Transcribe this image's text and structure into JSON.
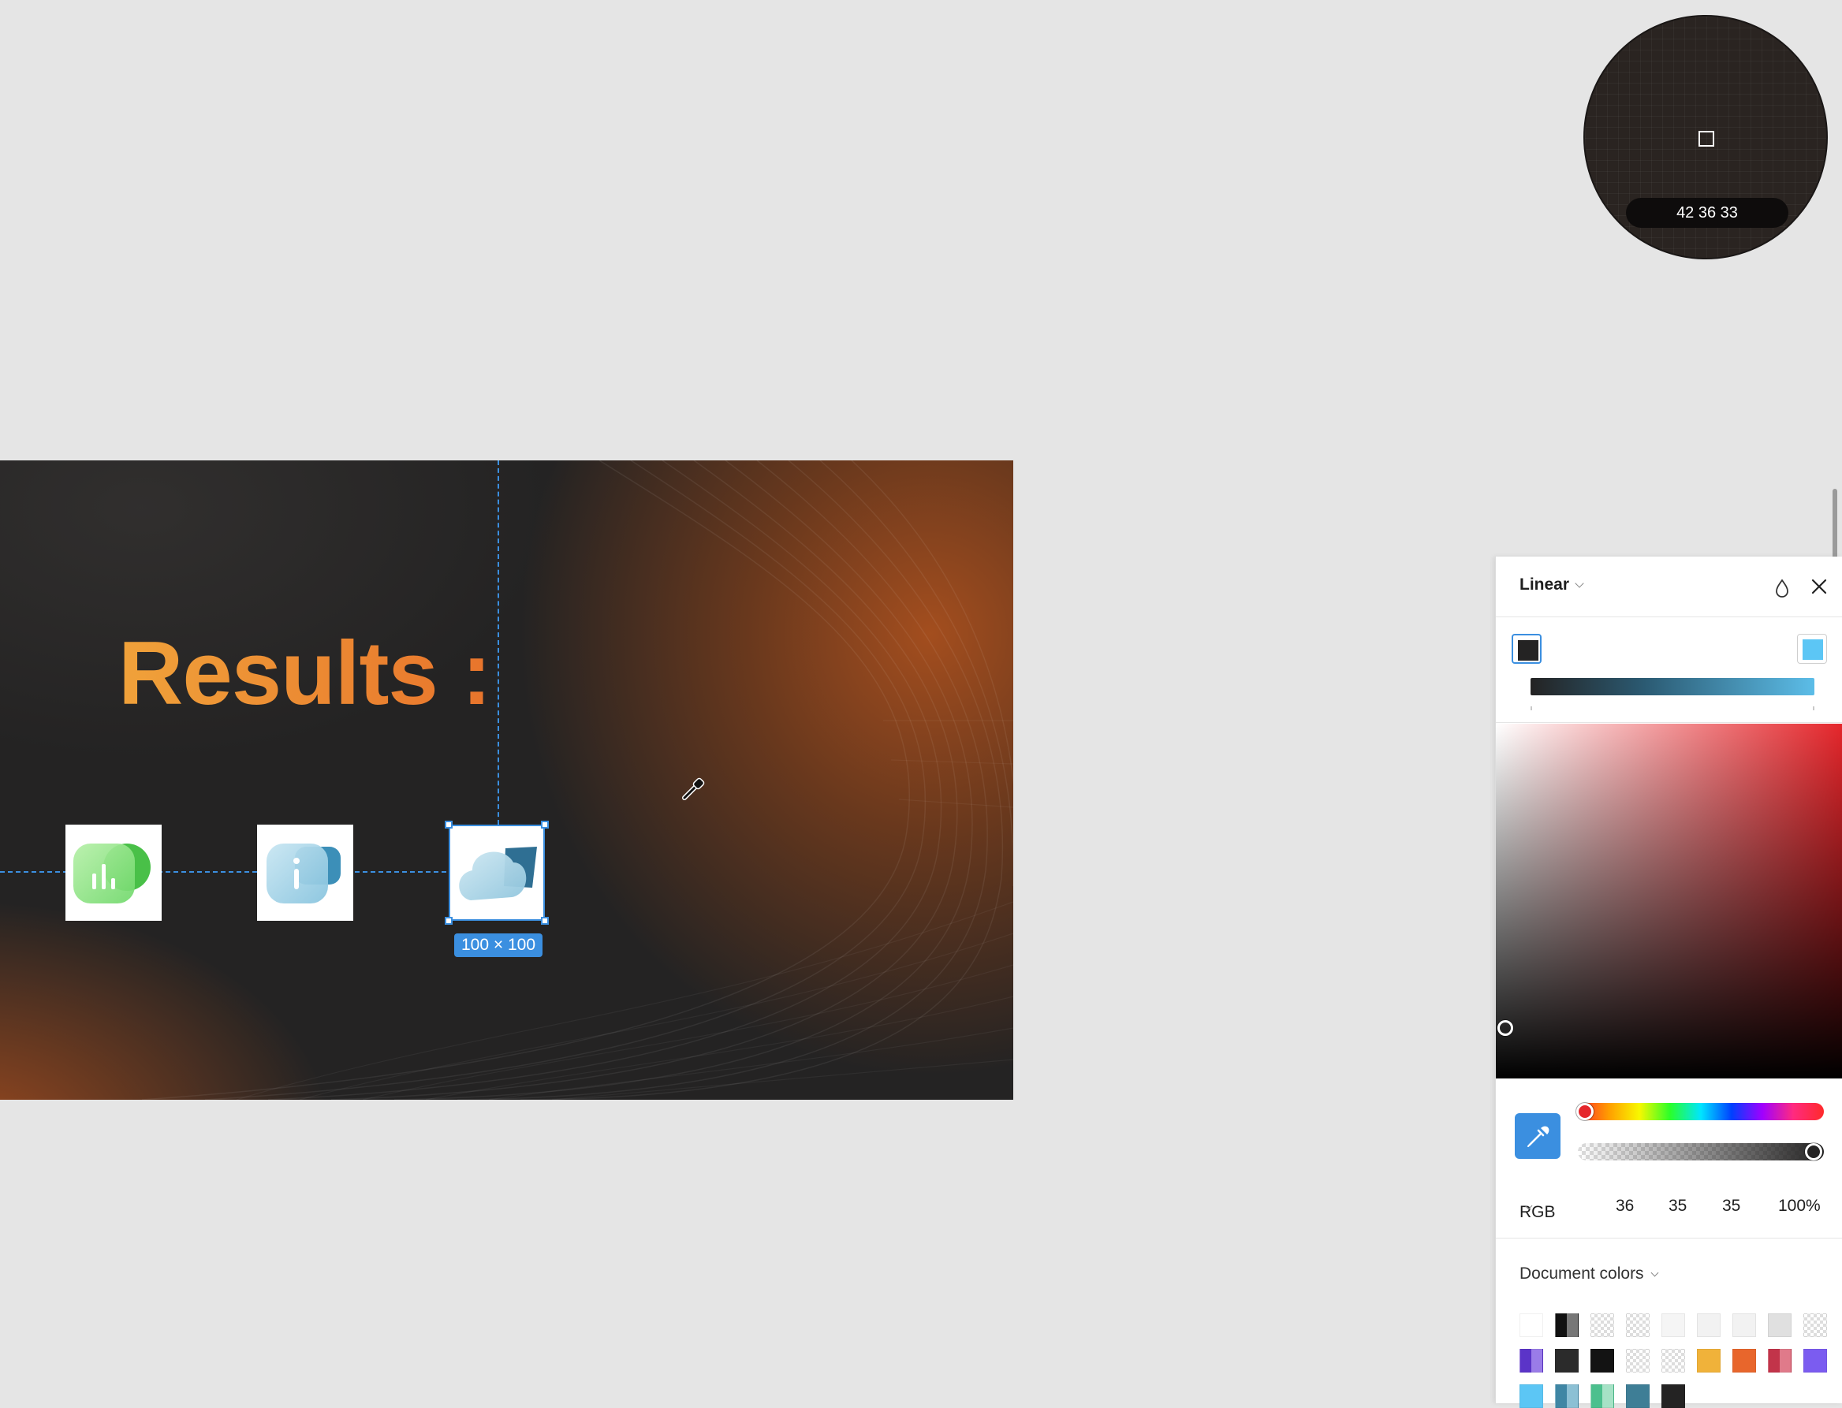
{
  "frame": {
    "title": "Results :",
    "selection_size": "100 × 100",
    "icons": [
      {
        "name": "chart-bubble-icon",
        "color": "#5fcf5f"
      },
      {
        "name": "info-bubble-icon",
        "color": "#6eb6dc"
      },
      {
        "name": "cloud-bubble-icon",
        "color": "#8ec9e0"
      }
    ]
  },
  "loupe": {
    "readout": "42 36 33"
  },
  "color_panel": {
    "fill_type": "Linear",
    "gradient": {
      "stop_start": "#242323",
      "stop_end": "#5cbde8"
    },
    "color_mode": "RGB",
    "r": "36",
    "g": "35",
    "b": "35",
    "opacity": "100%",
    "document_colors_label": "Document colors",
    "hue_position": 0.0,
    "alpha_position": 1.0,
    "document_colors": [
      [
        "#ffffff",
        "split-black",
        "checker",
        "checker",
        "#f5f5f5",
        "#f2f2f2",
        "#f2f2f2",
        "#e0e0e0",
        "checker"
      ],
      [
        "split-purple",
        "#2b2b2b",
        "#131313",
        "checker",
        "checker",
        "#f0b23a",
        "#e8662c",
        "split-red",
        "#7b5cf0"
      ],
      [
        "#5cc6f5",
        "split-teal",
        "split-green",
        "#3e7e96",
        "#242323"
      ]
    ]
  }
}
